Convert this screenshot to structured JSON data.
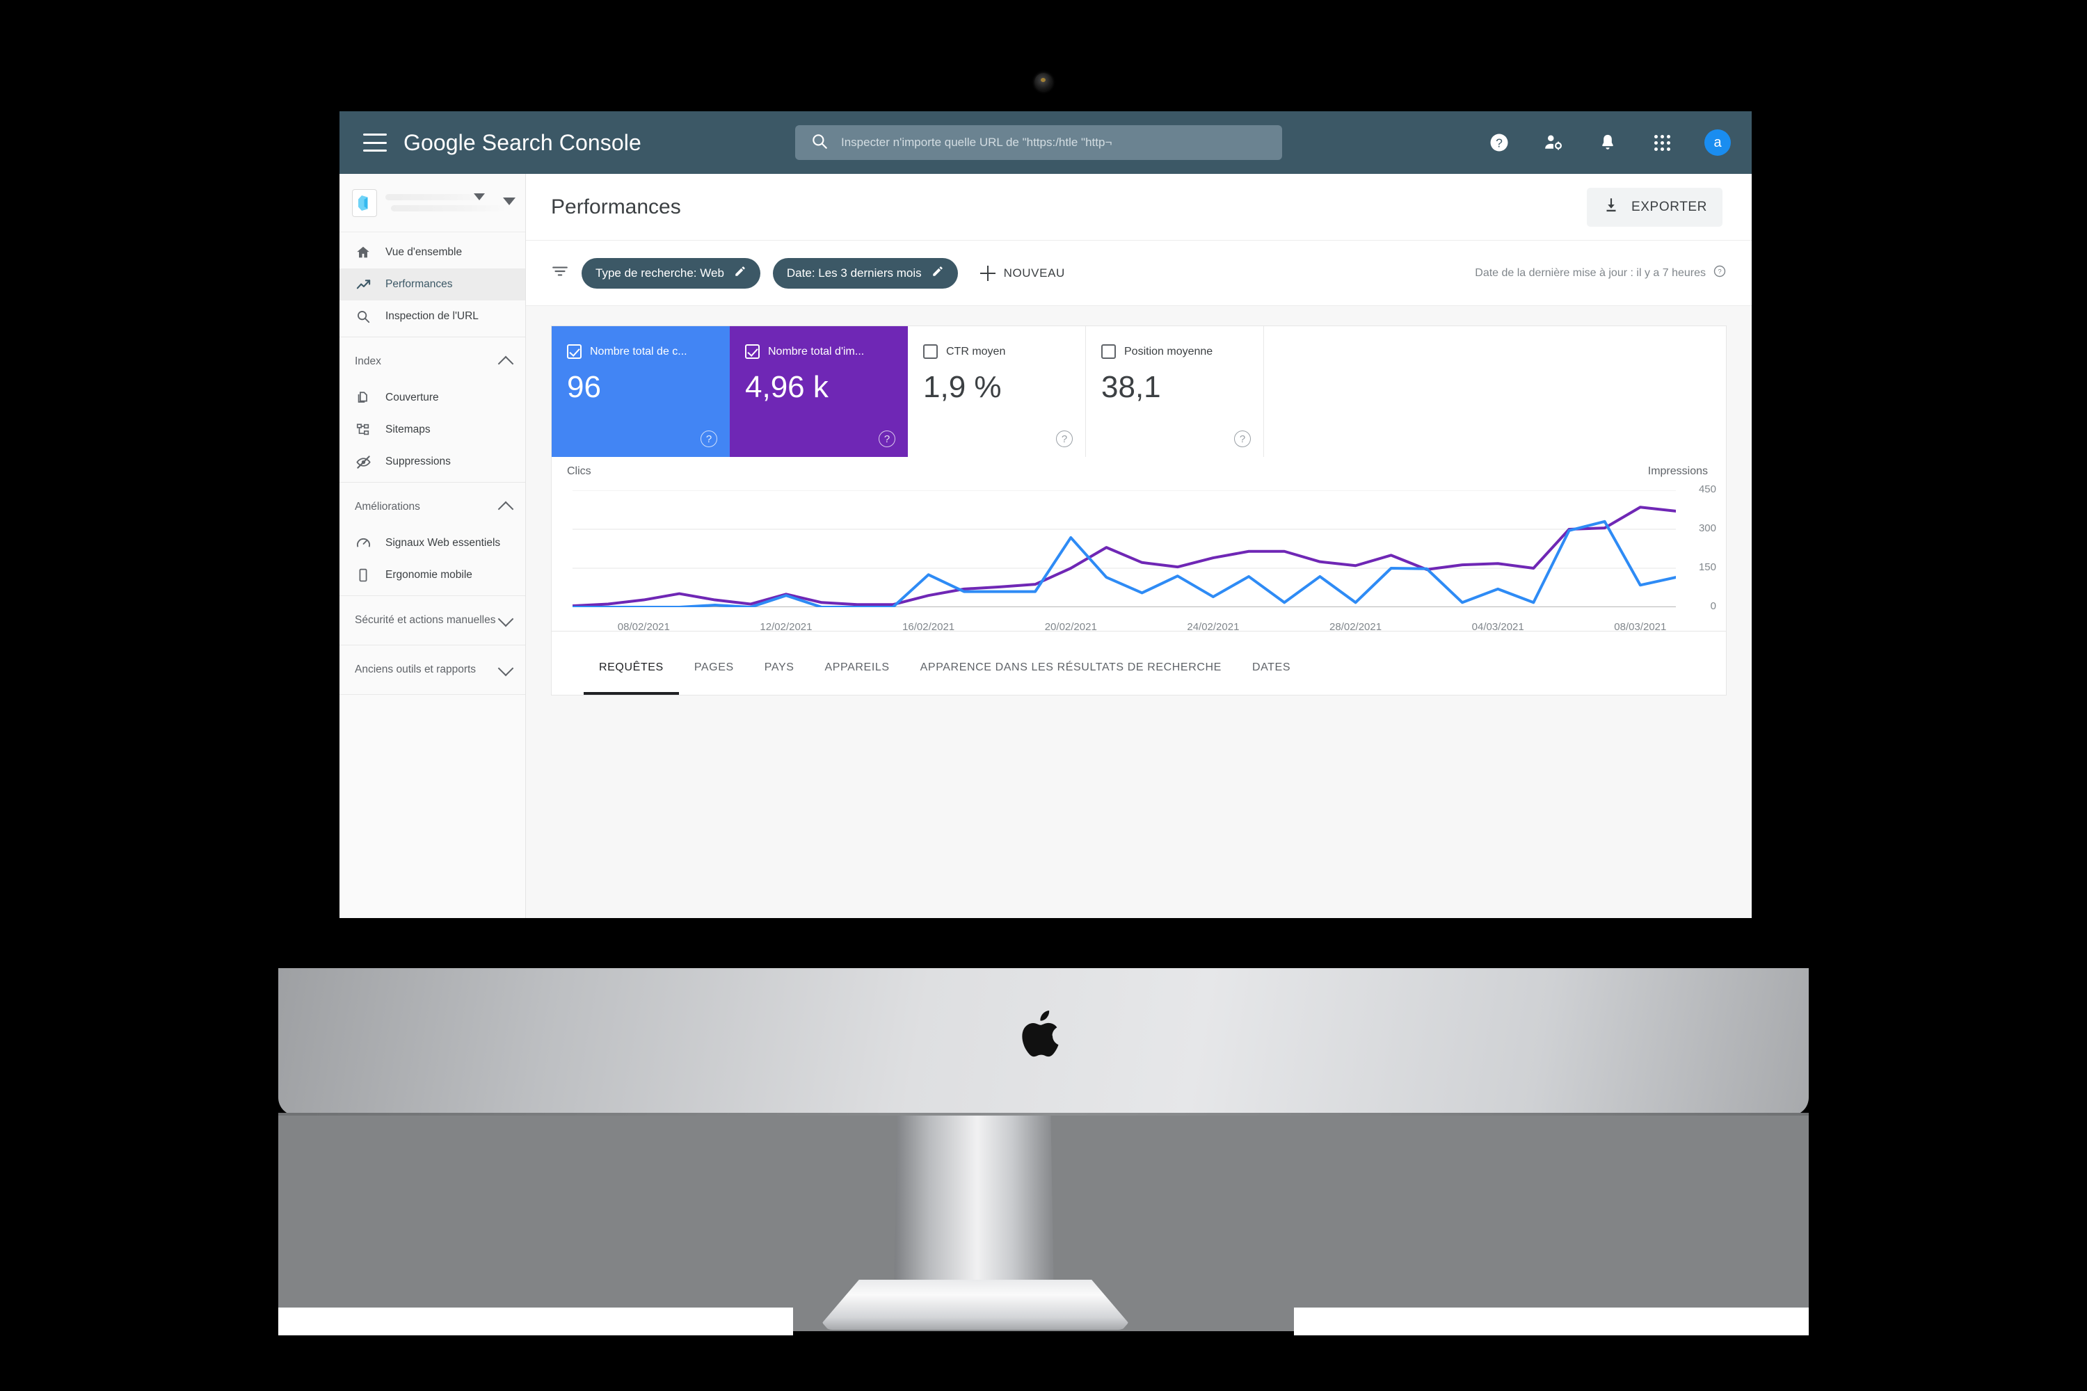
{
  "header": {
    "brand_part1": "Google",
    "brand_part2": " Search Console",
    "menu_icon": "hamburger-icon",
    "search_placeholder": "Inspecter n'importe quelle URL de \"https:/htle \"http¬",
    "help_icon": "help-icon",
    "account_settings_icon": "account-settings-icon",
    "notifications_icon": "bell-icon",
    "apps_icon": "apps-grid-icon",
    "avatar_letter": "a",
    "bar_color": "#3c5866",
    "avatar_color": "#1a8df0"
  },
  "sidebar": {
    "property_selector_label": "",
    "groups": [
      {
        "items": [
          {
            "label": "Vue d'ensemble",
            "icon": "home-icon",
            "active": false
          },
          {
            "label": "Performances",
            "icon": "trending-up-icon",
            "active": true
          },
          {
            "label": "Inspection de l'URL",
            "icon": "search-icon",
            "active": false
          }
        ]
      },
      {
        "title": "Index",
        "expanded": true,
        "items": [
          {
            "label": "Couverture",
            "icon": "document-copy-icon",
            "active": false
          },
          {
            "label": "Sitemaps",
            "icon": "sitemap-icon",
            "active": false
          },
          {
            "label": "Suppressions",
            "icon": "eye-off-icon",
            "active": false
          }
        ]
      },
      {
        "title": "Améliorations",
        "expanded": true,
        "items": [
          {
            "label": "Signaux Web essentiels",
            "icon": "speedometer-icon",
            "active": false
          },
          {
            "label": "Ergonomie mobile",
            "icon": "mobile-icon",
            "active": false
          }
        ]
      },
      {
        "title": "Sécurité et actions manuelles",
        "expanded": false,
        "items": []
      },
      {
        "title": "Anciens outils et rapports",
        "expanded": false,
        "items": []
      }
    ]
  },
  "page": {
    "title": "Performances",
    "export_label": "EXPORTER",
    "export_icon": "download-icon"
  },
  "filters": {
    "filter_icon": "filter-icon",
    "chips": [
      {
        "label": "Type de recherche: Web",
        "edit_icon": "pencil-icon"
      },
      {
        "label": "Date: Les 3 derniers mois",
        "edit_icon": "pencil-icon"
      }
    ],
    "new_label": "NOUVEAU",
    "new_icon": "plus-icon",
    "last_update": "Date de la dernière mise à jour : il y a 7 heures",
    "last_update_help_icon": "help-circle-icon"
  },
  "metrics": [
    {
      "label": "Nombre total de c...",
      "value": "96",
      "checked": true,
      "color": "#4285f4",
      "help_icon": "help-circle-icon"
    },
    {
      "label": "Nombre total d'im...",
      "value": "4,96 k",
      "checked": true,
      "color": "#6f27b5",
      "help_icon": "help-circle-icon"
    },
    {
      "label": "CTR moyen",
      "value": "1,9 %",
      "checked": false,
      "color": "#ffffff",
      "help_icon": "help-circle-icon"
    },
    {
      "label": "Position moyenne",
      "value": "38,1",
      "checked": false,
      "color": "#ffffff",
      "help_icon": "help-circle-icon"
    }
  ],
  "tabs": [
    {
      "label": "REQUÊTES",
      "active": true
    },
    {
      "label": "PAGES",
      "active": false
    },
    {
      "label": "PAYS",
      "active": false
    },
    {
      "label": "APPAREILS",
      "active": false
    },
    {
      "label": "APPARENCE DANS LES RÉSULTATS DE RECHERCHE",
      "active": false
    },
    {
      "label": "DATES",
      "active": false
    }
  ],
  "chart_data": {
    "type": "line",
    "title": "",
    "ylabel_left": "Clics",
    "ylabel_right": "Impressions",
    "grid": true,
    "legend_position": "none",
    "yticks_right": [
      0,
      150,
      300,
      450
    ],
    "ylim_right": [
      0,
      450
    ],
    "ylim_left": [
      0,
      45
    ],
    "x": [
      "06/02/2021",
      "07/02/2021",
      "08/02/2021",
      "09/02/2021",
      "10/02/2021",
      "11/02/2021",
      "12/02/2021",
      "13/02/2021",
      "14/02/2021",
      "15/02/2021",
      "16/02/2021",
      "17/02/2021",
      "18/02/2021",
      "19/02/2021",
      "20/02/2021",
      "21/02/2021",
      "22/02/2021",
      "23/02/2021",
      "24/02/2021",
      "25/02/2021",
      "26/02/2021",
      "27/02/2021",
      "28/02/2021",
      "01/03/2021",
      "02/03/2021",
      "03/03/2021",
      "04/03/2021",
      "05/03/2021",
      "06/03/2021",
      "07/03/2021",
      "08/03/2021",
      "09/03/2021"
    ],
    "xtick_labels": [
      "08/02/2021",
      "12/02/2021",
      "16/02/2021",
      "20/02/2021",
      "24/02/2021",
      "28/02/2021",
      "04/03/2021",
      "08/03/2021"
    ],
    "series": [
      {
        "name": "Impressions",
        "color": "#6f27b5",
        "axis": "right",
        "values": [
          5,
          12,
          28,
          52,
          28,
          12,
          50,
          18,
          10,
          10,
          45,
          70,
          78,
          88,
          150,
          230,
          172,
          155,
          190,
          215,
          215,
          175,
          160,
          200,
          145,
          163,
          168,
          150,
          300,
          305,
          385,
          370
        ]
      },
      {
        "name": "Clics",
        "color": "#2e8bf5",
        "axis": "left",
        "values": [
          0,
          0,
          0,
          0,
          8,
          0,
          45,
          0,
          0,
          0,
          125,
          60,
          60,
          60,
          268,
          115,
          55,
          120,
          40,
          118,
          18,
          118,
          18,
          150,
          148,
          18,
          70,
          18,
          295,
          330,
          85,
          115
        ]
      }
    ]
  }
}
